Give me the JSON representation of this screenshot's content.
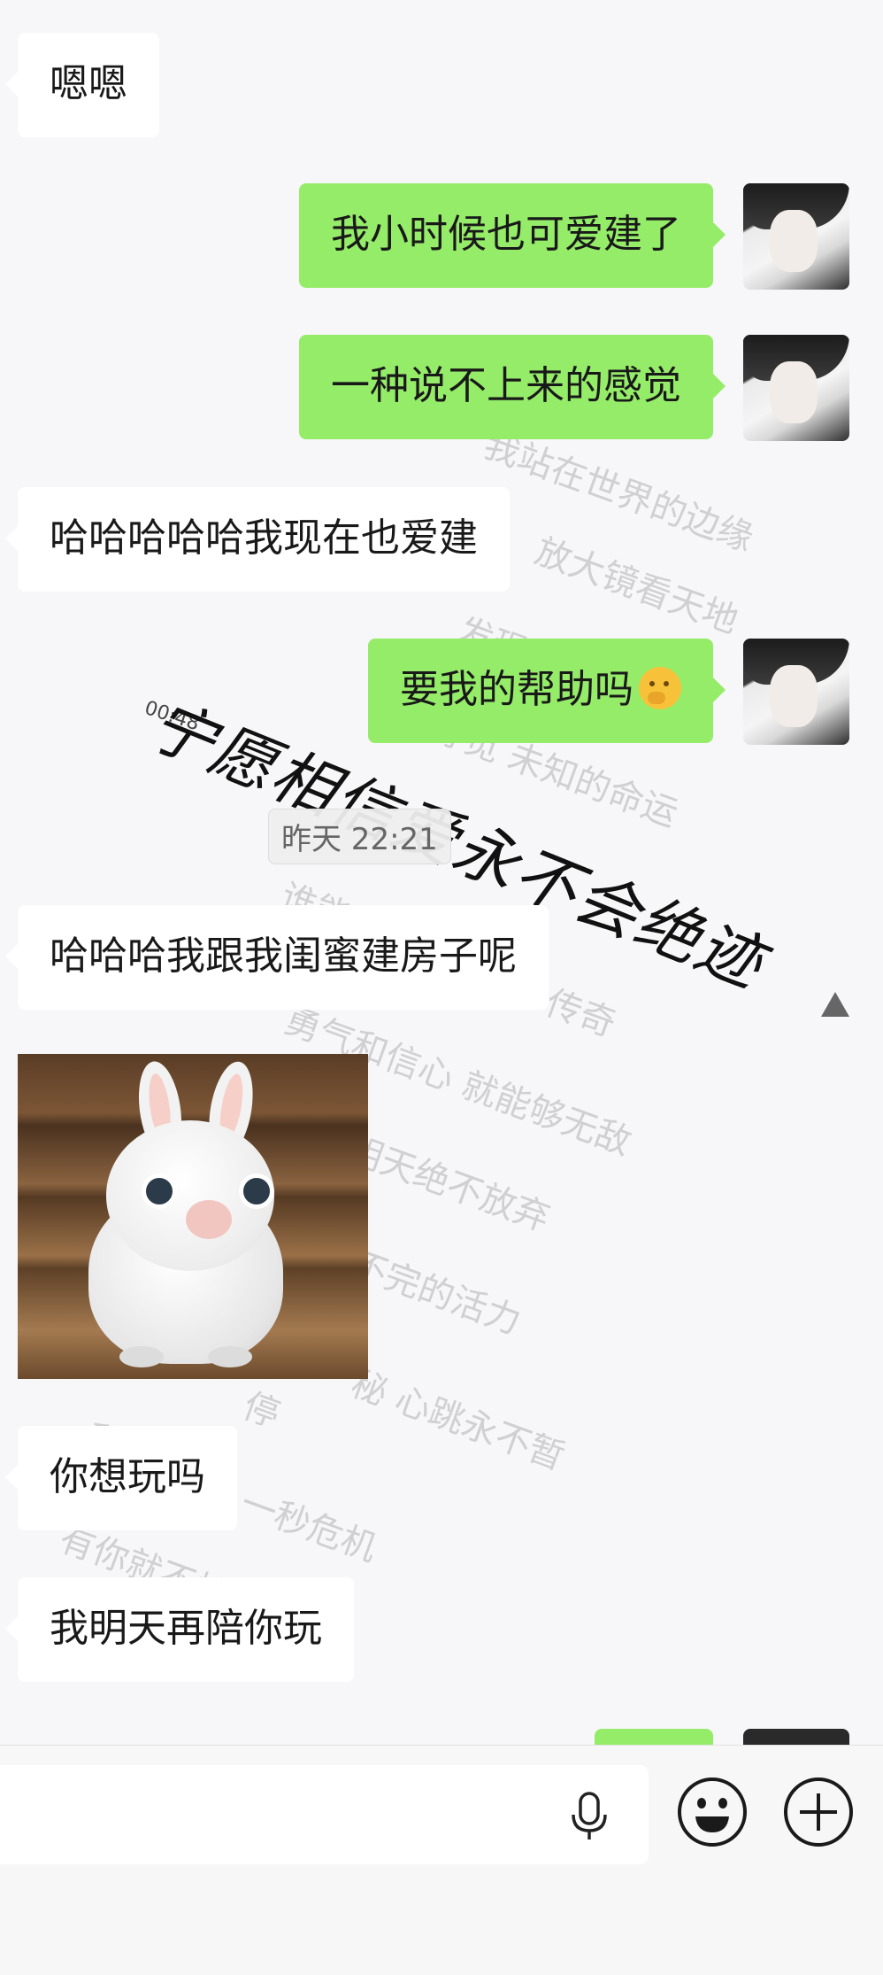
{
  "wallpaper": {
    "lyrics": [
      "我站在世界的边缘",
      "放大镜看天地",
      "发现",
      "寻觅 未知的命运",
      "谁能",
      "传奇",
      "勇气和信心 就能够无敌",
      "明天绝不放弃",
      "不完的活力",
      "秘 心跳永不暂",
      "停",
      "一秒危机",
      "我",
      "有你就不怕"
    ],
    "signature": "宁愿相信爱永不会绝迹",
    "audio_time": "00:48"
  },
  "messages": [
    {
      "side": "left",
      "text": "嗯嗯"
    },
    {
      "side": "right",
      "text": "我小时候也可爱建了"
    },
    {
      "side": "right",
      "text": "一种说不上来的感觉"
    },
    {
      "side": "left",
      "text": "哈哈哈哈哈我现在也爱建"
    },
    {
      "side": "right",
      "text": "要我的帮助吗",
      "emoji": "thinking-face"
    },
    {
      "side": "left",
      "text": "哈哈哈我跟我闺蜜建房子呢"
    },
    {
      "side": "left",
      "text": "你想玩吗"
    },
    {
      "side": "left",
      "text": "我明天再陪你玩"
    }
  ],
  "timestamp": "昨天 22:21",
  "input": {
    "placeholder": "",
    "icons": {
      "voice": "microphone-icon",
      "emoji": "smiley-icon",
      "more": "plus-circle-icon"
    }
  },
  "colors": {
    "sent_bubble": "#95ec69",
    "received_bubble": "#ffffff",
    "background": "#ededed"
  }
}
